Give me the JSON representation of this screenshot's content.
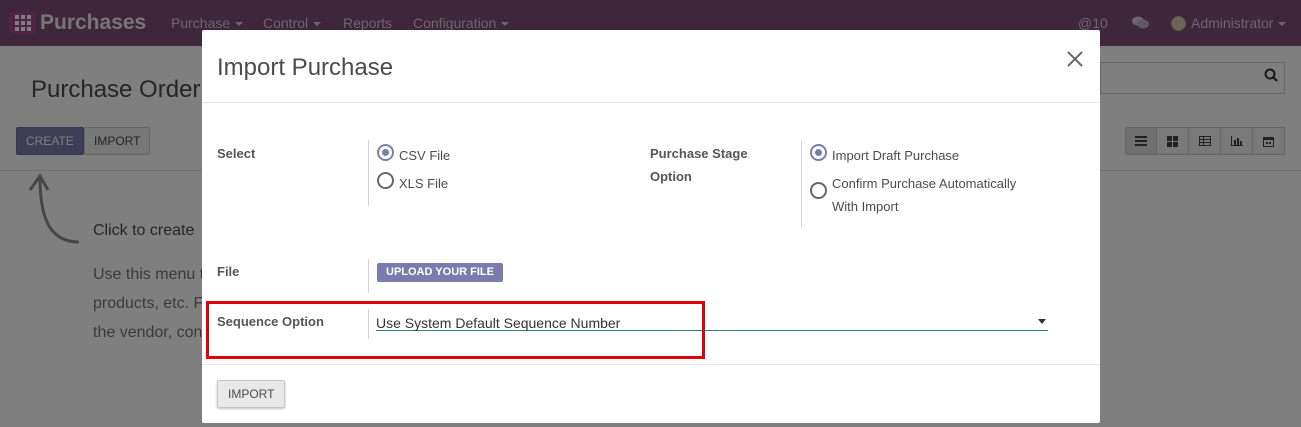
{
  "navbar": {
    "app_name": "Purchases",
    "menus": [
      "Purchase",
      "Control",
      "Reports",
      "Configuration"
    ],
    "activity_count": "@10",
    "user_name": "Administrator"
  },
  "background_page": {
    "title": "Purchase Order",
    "create_label": "CREATE",
    "import_label": "IMPORT",
    "help_title": "Click to create",
    "help_lines": [
      "Use this menu t",
      "products, etc. F",
      "the vendor, con"
    ]
  },
  "modal": {
    "title": "Import Purchase",
    "select_label": "Select",
    "file_type_options": [
      "CSV File",
      "XLS File"
    ],
    "file_type_selected": "CSV File",
    "stage_label_line1": "Purchase Stage",
    "stage_label_line2": "Option",
    "stage_option_1": "Import Draft Purchase",
    "stage_option_2_line1": "Confirm Purchase Automatically",
    "stage_option_2_line2": "With Import",
    "stage_selected": "Import Draft Purchase",
    "file_label": "File",
    "upload_label": "UPLOAD YOUR FILE",
    "sequence_label": "Sequence Option",
    "sequence_value": "Use System Default Sequence Number",
    "import_button_label": "IMPORT"
  },
  "colors": {
    "navbar": "#7c4f74",
    "primary": "#7c7bad",
    "highlight": "#e0000e",
    "field_underline": "#2b8375"
  }
}
